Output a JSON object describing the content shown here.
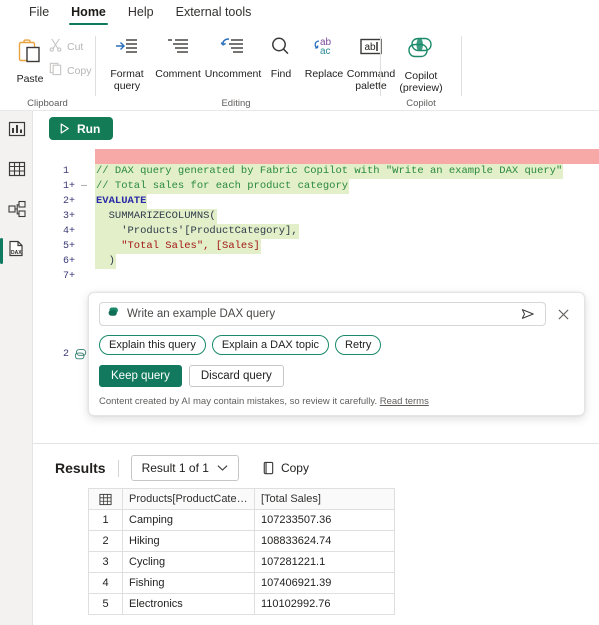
{
  "ribbon": {
    "tabs": [
      {
        "label": "File",
        "active": false
      },
      {
        "label": "Home",
        "active": true
      },
      {
        "label": "Help",
        "active": false
      },
      {
        "label": "External tools",
        "active": false
      }
    ],
    "groups": {
      "clipboard": {
        "label": "Clipboard",
        "paste": "Paste",
        "cut": "Cut",
        "copy": "Copy"
      },
      "editing": {
        "label": "Editing",
        "items": [
          {
            "label": "Format\nquery",
            "icon": "format-query-icon"
          },
          {
            "label": "Comment",
            "icon": "comment-icon"
          },
          {
            "label": "Uncomment",
            "icon": "uncomment-icon"
          },
          {
            "label": "Find",
            "icon": "find-icon"
          },
          {
            "label": "Replace",
            "icon": "replace-icon"
          },
          {
            "label": "Command\npalette",
            "icon": "command-palette-icon"
          }
        ]
      },
      "copilot": {
        "label": "Copilot",
        "button": "Copilot\n(preview)"
      }
    }
  },
  "rail": {
    "items": [
      {
        "name": "report-view",
        "selected": false
      },
      {
        "name": "table-view",
        "selected": false
      },
      {
        "name": "model-view",
        "selected": false
      },
      {
        "name": "dax-query-view",
        "selected": true
      }
    ]
  },
  "toolbar": {
    "run_label": "Run"
  },
  "editor": {
    "deleted_line_number": "1",
    "lines": [
      {
        "num": "1+",
        "type": "comment",
        "text": "// DAX query generated by Fabric Copilot with \"Write an example DAX query\""
      },
      {
        "num": "2+",
        "type": "comment",
        "text": "// Total sales for each product category"
      },
      {
        "num": "3+",
        "type": "keyword",
        "text": "EVALUATE"
      },
      {
        "num": "4+",
        "type": "function",
        "text": "  SUMMARIZECOLUMNS("
      },
      {
        "num": "5+",
        "type": "column",
        "text": "    'Products'[ProductCategory],"
      },
      {
        "num": "6+",
        "type": "measure",
        "text": "    \"Total Sales\", [Sales]"
      },
      {
        "num": "7+",
        "type": "punct",
        "text": "  )"
      }
    ],
    "next_line_number": "2"
  },
  "copilot_popup": {
    "prompt_value": "Write an example DAX query",
    "send_title": "Send",
    "close_title": "Close",
    "chips": [
      "Explain this query",
      "Explain a DAX topic",
      "Retry"
    ],
    "keep_label": "Keep query",
    "discard_label": "Discard query",
    "disclaimer": "Content created by AI may contain mistakes, so review it carefully.",
    "disclaimer_link": "Read terms"
  },
  "results": {
    "title": "Results",
    "selector": "Result 1 of 1",
    "copy_label": "Copy",
    "columns": [
      "Products[ProductCateg...",
      "[Total Sales]"
    ],
    "rows": [
      {
        "idx": "1",
        "category": "Camping",
        "total": "107233507.36"
      },
      {
        "idx": "2",
        "category": "Hiking",
        "total": "108833624.74"
      },
      {
        "idx": "3",
        "category": "Cycling",
        "total": "107281221.1"
      },
      {
        "idx": "4",
        "category": "Fishing",
        "total": "107406921.39"
      },
      {
        "idx": "5",
        "category": "Electronics",
        "total": "110102992.76"
      }
    ]
  },
  "colors": {
    "accent": "#12795e",
    "tab_underline": "#0f7a5f",
    "diff_added": "#e2efc8",
    "diff_removed": "#f7a9a8",
    "paste_icon": "#e8a33d"
  }
}
